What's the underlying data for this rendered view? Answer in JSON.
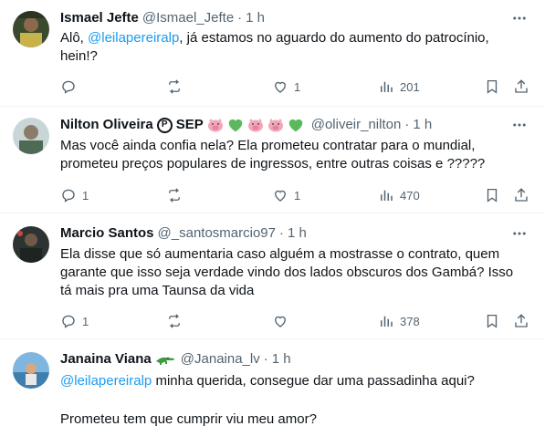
{
  "tweets": [
    {
      "name": "Ismael Jefte",
      "handle": "@Ismael_Jefte",
      "time": "1 h",
      "text_mention": "@leilapereiralp",
      "text_pre": "Alô, ",
      "text_post": ", já estamos no aguardo do aumento do patrocínio, hein!?",
      "replies": "",
      "retweets": "",
      "likes": "1",
      "views": "201"
    },
    {
      "name": "Nilton Oliveira",
      "badge": "P",
      "name_suffix": "SEP",
      "handle": "@oliveir_nilton",
      "time": "1 h",
      "text": "Mas você ainda confia nela? Ela prometeu contratar para o mundial, prometeu preços populares de ingressos, entre outras coisas e ?????",
      "replies": "1",
      "retweets": "",
      "likes": "1",
      "views": "470"
    },
    {
      "name": "Marcio Santos",
      "handle": "@_santosmarcio97",
      "time": "1 h",
      "text": "Ela disse que só aumentaria caso alguém a mostrasse o contrato, quem garante que isso seja verdade vindo dos lados obscuros dos Gambá? Isso tá mais pra uma Taunsa da vida",
      "replies": "1",
      "retweets": "",
      "likes": "",
      "views": "378"
    },
    {
      "name": "Janaina Viana",
      "handle": "@Janaina_lv",
      "time": "1 h",
      "text_mention": "@leilapereiralp",
      "text_post": " minha querida, consegue dar uma passadinha aqui?",
      "text_line2": "Prometeu tem que cumprir viu meu amor?"
    }
  ],
  "colors": {
    "accent": "#1d9bf0",
    "muted": "#536471",
    "text": "#0f1419",
    "heart_green": "#5cb85c",
    "pig_pink": "#f4a6b8"
  }
}
